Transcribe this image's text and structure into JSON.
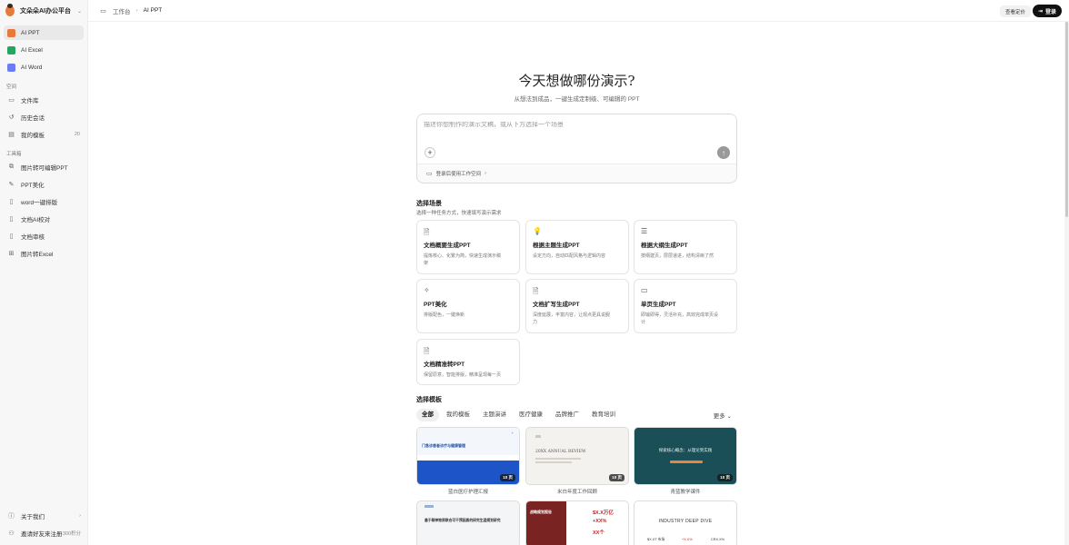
{
  "app": {
    "brand": "文朵朵AI办公平台"
  },
  "sidebar": {
    "apps": [
      {
        "label": "AI PPT",
        "color": "#e8793a"
      },
      {
        "label": "AI Excel",
        "color": "#25a55f"
      },
      {
        "label": "AI Word",
        "color": "#6b7cf6"
      }
    ],
    "space_label": "空间",
    "space_items": [
      {
        "label": "文件库",
        "icon": "folder-icon"
      },
      {
        "label": "历史会话",
        "icon": "history-icon"
      },
      {
        "label": "我的模板",
        "icon": "template-icon",
        "count": "20"
      }
    ],
    "tools_label": "工具箱",
    "tools": [
      {
        "label": "图片转可编辑PPT",
        "icon": "image-convert-icon"
      },
      {
        "label": "PPT美化",
        "icon": "brush-icon"
      },
      {
        "label": "word一键排版",
        "icon": "doc-icon"
      },
      {
        "label": "文档AI校对",
        "icon": "proofread-icon"
      },
      {
        "label": "文档审核",
        "icon": "review-icon"
      },
      {
        "label": "图片转Excel",
        "icon": "image-excel-icon"
      }
    ],
    "about": "关于我们",
    "invite": "邀请好友来注册",
    "invite_points": "300积分"
  },
  "header": {
    "breadcrumb_root": "工作台",
    "breadcrumb_current": "AI PPT",
    "pricing": "查看定价",
    "login": "登录"
  },
  "hero": {
    "title": "今天想做哪份演示?",
    "subtitle": "从想法到成品，一键生成定制级、可编辑的 PPT"
  },
  "prompt": {
    "placeholder": "描述你想制作的演示文稿，或从下方选择一个场景",
    "workspace_link": "登录后使用工作空间"
  },
  "scenes": {
    "title": "选择场景",
    "desc": "选择一种任务方式，快速填写演示需求",
    "cards": [
      {
        "title": "文档概要生成PPT",
        "desc": "提炼核心、化繁为简，快速生成演示稿",
        "desc2": "架",
        "icon": "document-icon"
      },
      {
        "title": "根据主题生成PPT",
        "desc": "设定方向，自动匹配风格与逻辑内容",
        "icon": "bulb-icon"
      },
      {
        "title": "根据大纲生成PPT",
        "desc": "按纲建页，层层递进，结构清晰了然",
        "icon": "outline-icon"
      },
      {
        "title": "PPT美化",
        "desc": "排版配色，一键焕新",
        "icon": "sparkle-icon"
      },
      {
        "title": "文档扩写生成PPT",
        "desc": "深度延展，丰富内容，让观点更具说服",
        "desc2": "力",
        "icon": "document-icon"
      },
      {
        "title": "单页生成PPT",
        "desc": "即输即得，灵活补充，高效完成单页设",
        "desc2": "计",
        "icon": "monitor-icon"
      },
      {
        "title": "文档精准转PPT",
        "desc": "保留原意，智能排版，精准呈现每一页",
        "icon": "document-icon"
      }
    ]
  },
  "templates": {
    "title": "选择模板",
    "tabs": [
      "全部",
      "我的模板",
      "主题演讲",
      "医疗健康",
      "品牌推广",
      "教育培训"
    ],
    "more": "更多",
    "items": [
      {
        "caption": "蓝白医疗护理汇报",
        "pages": "10 页",
        "heading": "门急诊患者诊疗与健康管理"
      },
      {
        "caption": "米白年度工作回顾",
        "pages": "10 页",
        "heading": "20XX ANNUAL REVIEW"
      },
      {
        "caption": "青蓝教学课件",
        "pages": "10 页",
        "heading": "探索核心概念：从理论到实践"
      },
      {
        "heading": "基于精神物质联合可干预因素的研究生涯规划研究"
      },
      {
        "heading": "战略规划报告",
        "stats": [
          "$X.X万亿",
          "+XX%",
          "XX个"
        ]
      },
      {
        "heading": "INDUSTRY DEEP DIVE",
        "stats": [
          "$X.XT 市场",
          "+X.X%",
          "CRX.X%"
        ]
      }
    ]
  }
}
